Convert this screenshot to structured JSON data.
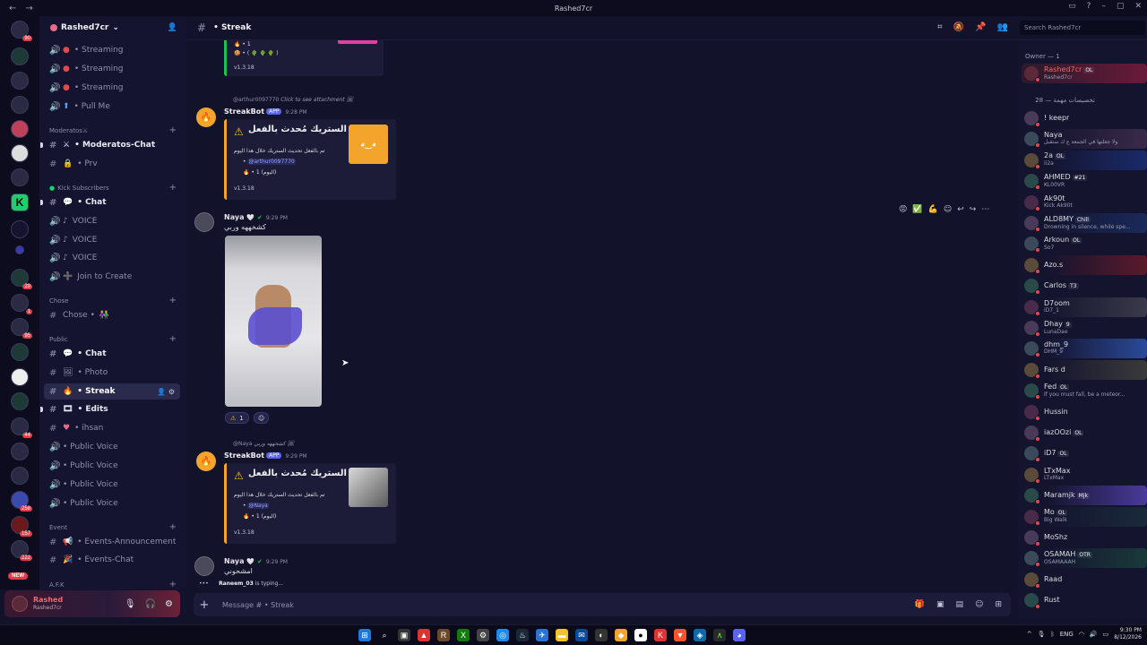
{
  "window": {
    "title": "Rashed7cr"
  },
  "server_rail": {
    "badges": [
      "90",
      "29",
      "1",
      "95",
      "44",
      "258",
      "157",
      "222"
    ],
    "new_label": "NEW"
  },
  "sidebar": {
    "guild_name": "Rashed7cr",
    "channels_top": [
      {
        "label": "• Streaming",
        "icon": "red-dot"
      },
      {
        "label": "• Streaming",
        "icon": "red-dot"
      },
      {
        "label": "• Streaming",
        "icon": "red-dot"
      },
      {
        "label": "• Pull Me",
        "icon": "arrow-up-icon"
      }
    ],
    "cat_moderators": "Moderatos",
    "moderators": [
      {
        "label": "• Moderatos-Chat"
      },
      {
        "label": "• Prv"
      }
    ],
    "cat_kick": "Kick Subscribers",
    "kick": [
      {
        "label": "• Chat"
      },
      {
        "label": "VOICE"
      },
      {
        "label": "VOICE"
      },
      {
        "label": "VOICE"
      },
      {
        "label": "Join to Create"
      }
    ],
    "cat_chose": "Chose",
    "chose": [
      {
        "label": "Chose •"
      }
    ],
    "cat_public": "Public",
    "public": [
      {
        "label": "• Chat"
      },
      {
        "label": "• Photo"
      },
      {
        "label": "• Streak"
      },
      {
        "label": "• Edits"
      },
      {
        "label": "• ihsan"
      },
      {
        "label": "• Public Voice"
      },
      {
        "label": "• Public Voice"
      },
      {
        "label": "• Public Voice"
      },
      {
        "label": "• Public Voice"
      }
    ],
    "cat_event": "Event",
    "event": [
      {
        "label": "• Events-Announcement"
      },
      {
        "label": "• Events-Chat"
      }
    ],
    "cat_afk": "A.F.K"
  },
  "user_panel": {
    "display_name": "Rashed",
    "username": "Rashed7cr"
  },
  "header": {
    "channel": "• Streak",
    "search_placeholder": "Search Rashed7cr"
  },
  "messages": {
    "top_embed": {
      "line1": "1",
      "version": "v1.3.18"
    },
    "m1": {
      "reply_user": "@arthur0097770",
      "reply_text": "Click to see attachment",
      "author": "StreakBot",
      "app": "APP",
      "time": "9:28 PM",
      "embed_title": "الستريك مُحدث بالفعل",
      "embed_desc": "تم بالفعل تحديث الستريك خلال هذا اليوم",
      "embed_mention": "@arthur0097770",
      "embed_count": "1 (اليوم)",
      "version": "v1.3.18"
    },
    "m2": {
      "author": "Naya",
      "time": "9:29 PM",
      "text": "كشخههه وربي",
      "reaction_count": "1"
    },
    "m3": {
      "reply_user": "@Naya",
      "reply_text": "كشخههه وربي",
      "author": "StreakBot",
      "app": "APP",
      "time": "9:29 PM",
      "embed_title": "الستريك مُحدث بالفعل",
      "embed_desc": "تم بالفعل تحديث الستريك خلال هذا اليوم",
      "embed_mention": "@Naya",
      "embed_count": "1 (اليوم)",
      "version": "v1.3.18"
    },
    "m4": {
      "author": "Naya",
      "time": "9:29 PM",
      "text": "امشحوني"
    },
    "typing": {
      "user": "Raneem_03",
      "text": " is typing..."
    }
  },
  "composer": {
    "placeholder": "Message # • Streak"
  },
  "members": {
    "owner_header": "Owner — 1",
    "role_header": "تخصيصات مهمة — 28",
    "owner": {
      "name": "Rashed7cr",
      "status": "Rashed7cr",
      "tag": "OL"
    },
    "list": [
      {
        "name": "! keepr",
        "status": ""
      },
      {
        "name": "Naya",
        "status": "ولا جعلتها في الجمعة ع ك ستقبل",
        "bg": "#3a2a4a"
      },
      {
        "name": "2a",
        "status": "ii2a",
        "tag": "OL",
        "bg": "#1a2a6a"
      },
      {
        "name": "AHMED",
        "status": "KL00VR",
        "tag": "#21"
      },
      {
        "name": "Ak90t",
        "status": "Kick Ak90t"
      },
      {
        "name": "ALD8MY",
        "status": "Drowning in silence, while spe...",
        "tag": "Chill",
        "bg": "#1a2a5a"
      },
      {
        "name": "Arkoun",
        "status": "So7",
        "tag": "OL"
      },
      {
        "name": "Azo.s",
        "status": "",
        "bg": "#5a1a2a"
      },
      {
        "name": "Carlos",
        "status": "",
        "tag": "T3"
      },
      {
        "name": "D7oom",
        "status": "iD7_1",
        "bg": "#3a3a4a"
      },
      {
        "name": "Dhay",
        "status": "LunaDae",
        "tag": "9"
      },
      {
        "name": "dhm_9",
        "status": "DHM_9",
        "bg": "#2a4a9a"
      },
      {
        "name": "Fars d",
        "status": "",
        "bg": "#3a3a3a"
      },
      {
        "name": "Fed",
        "status": "If you must fall, be a meteor...",
        "tag": "OL"
      },
      {
        "name": "Hussin",
        "status": ""
      },
      {
        "name": "iazOOzi",
        "status": "",
        "tag": "OL"
      },
      {
        "name": "iD7",
        "status": "",
        "tag": "OL"
      },
      {
        "name": "LTxMax",
        "status": "LTxMax"
      },
      {
        "name": "Maramjk",
        "status": "",
        "tag": "Mjk",
        "bg": "#4a3a9a"
      },
      {
        "name": "Mo",
        "status": "Big Walk",
        "tag": "OL",
        "bg": "#1a2a3a"
      },
      {
        "name": "MoShz",
        "status": ""
      },
      {
        "name": "OSAMAH",
        "status": "OSAMAAAH",
        "tag": "OTR",
        "bg": "#1a3a3a"
      },
      {
        "name": "Raad",
        "status": ""
      },
      {
        "name": "Rust",
        "status": ""
      }
    ]
  },
  "taskbar": {
    "lang": "ENG",
    "time": "9:30 PM",
    "date": "8/12/2026"
  }
}
